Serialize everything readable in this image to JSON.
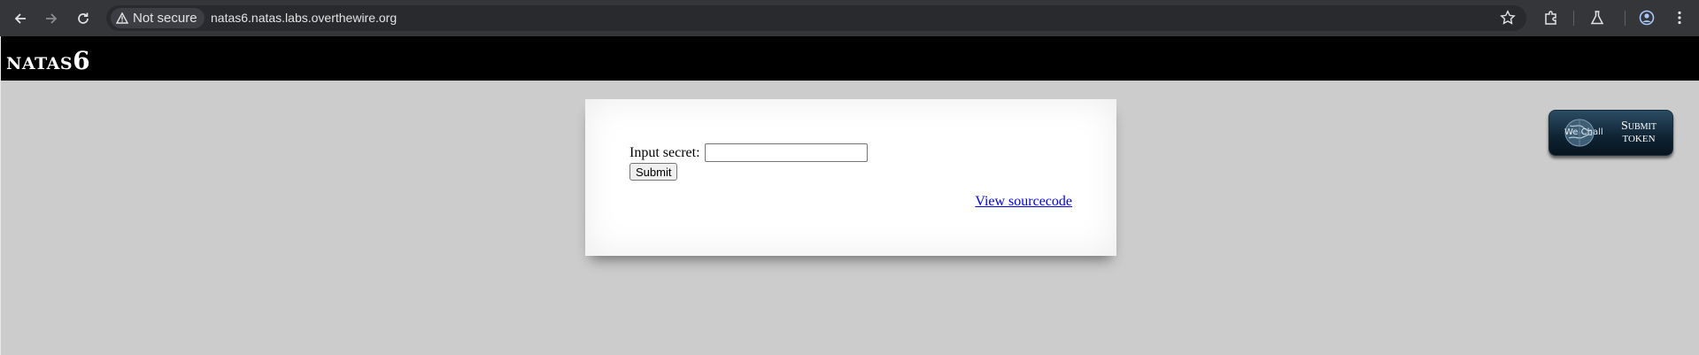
{
  "browser": {
    "security_label": "Not secure",
    "url": "natas6.natas.labs.overthewire.org"
  },
  "header": {
    "title_word": "NATAS",
    "title_number": "6"
  },
  "form": {
    "label": "Input secret:",
    "input_value": "",
    "submit_label": "Submit",
    "source_link": "View sourcecode"
  },
  "wechall": {
    "logo_text": "We Chall",
    "line1": "Submit",
    "line2": "TOKEN"
  }
}
